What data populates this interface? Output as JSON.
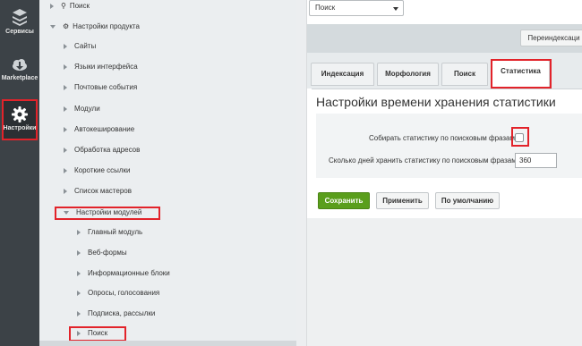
{
  "rail": {
    "items": [
      {
        "label": "Сервисы",
        "icon": "layers-icon"
      },
      {
        "label": "Marketplace",
        "icon": "cloud-download-icon"
      },
      {
        "label": "Настройки",
        "icon": "gear-icon"
      }
    ]
  },
  "tree": {
    "search_root": "Поиск",
    "product_settings": "Настройки продукта",
    "items": [
      "Сайты",
      "Языки интерфейса",
      "Почтовые события",
      "Модули",
      "Автокеширование",
      "Обработка адресов",
      "Короткие ссылки",
      "Список мастеров"
    ],
    "module_settings": "Настройки модулей",
    "modules": [
      "Главный модуль",
      "Веб-формы",
      "Информационные блоки",
      "Опросы, голосования",
      "Подписка, рассылки",
      "Поиск"
    ]
  },
  "toolbar": {
    "select_value": "Поиск",
    "reindex_label": "Переиндексаци"
  },
  "tabs": [
    "Индексация",
    "Морфология",
    "Поиск",
    "Статистика"
  ],
  "panel": {
    "title": "Настройки времени хранения статистики",
    "collect_label": "Собирать статистику по поисковым фразам:",
    "days_label": "Сколько дней хранить статистику по поисковым фразам:",
    "days_value": "360"
  },
  "buttons": {
    "save": "Сохранить",
    "apply": "Применить",
    "default": "По умолчанию"
  },
  "colors": {
    "highlight": "#e2232a",
    "save_green": "#5a9e1c",
    "rail_bg": "#3c4247"
  }
}
